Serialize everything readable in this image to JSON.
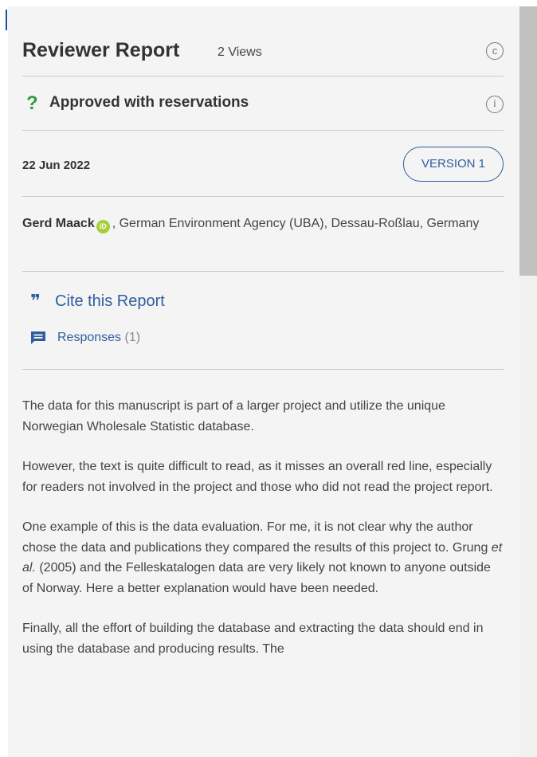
{
  "report": {
    "title": "Reviewer Report",
    "views": "2 Views",
    "license_icon": "creative-commons-icon",
    "status_icon": "question-mark-icon",
    "status": "Approved with reservations",
    "info_icon": "info-icon",
    "date": "22 Jun 2022",
    "version_label": "VERSION 1",
    "author_name": "Gerd Maack",
    "orcid_icon": "orcid-icon",
    "affiliation": ", German Environment Agency (UBA), Dessau-Roßlau, Germany"
  },
  "links": {
    "cite_icon": "quote-icon",
    "cite_label": "Cite this Report",
    "responses_icon": "comment-icon",
    "responses_label": "Responses",
    "responses_count": "(1)"
  },
  "body": {
    "p1": "The data for this manuscript is part of a larger project and utilize the unique Norwegian Wholesale Statistic database.",
    "p2": "However, the text is quite difficult to read, as it misses an overall red line, especially for readers not involved in the project and those who did not read the project report.",
    "p3_a": "One example of this is the data evaluation. For me, it is not clear why the author chose the data and publications they compared the results of this project to. Grung ",
    "p3_italic": "et al.",
    "p3_b": " (2005) and the Felleskatalogen data are very likely not known to anyone outside of Norway. Here a better explanation would have been needed.",
    "p4": "Finally, all the effort of building the database and extracting the data should end in using the database and producing results. The"
  },
  "colors": {
    "link": "#2e5d9e",
    "approved_reservations": "#2e9b3a",
    "orcid": "#a6ce39",
    "panel_bg": "#f4f4f4",
    "divider": "#c9c9c9"
  }
}
